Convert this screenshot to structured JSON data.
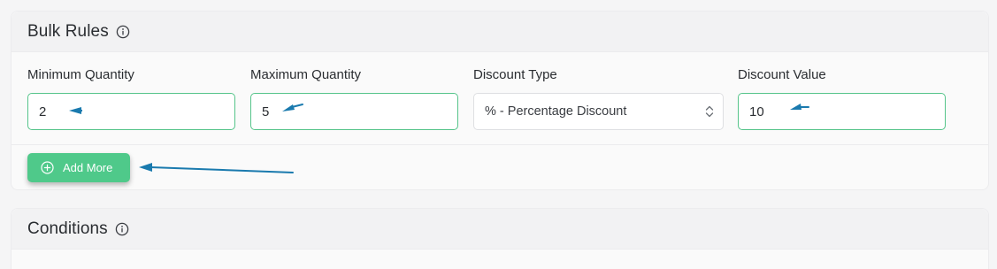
{
  "bulk_rules": {
    "title": "Bulk Rules",
    "fields": [
      {
        "label": "Minimum Quantity",
        "value": "2"
      },
      {
        "label": "Maximum Quantity",
        "value": "5"
      },
      {
        "label": "Discount Type",
        "value": "% - Percentage Discount"
      },
      {
        "label": "Discount Value",
        "value": "10"
      }
    ],
    "add_more_label": "Add More"
  },
  "conditions": {
    "title": "Conditions"
  },
  "colors": {
    "accent": "#4fc98a",
    "input_border": "#55c48a",
    "annotation_arrow": "#1a7aae"
  },
  "icons": [
    "info-icon",
    "sort-icon",
    "plus-circle-icon",
    "arrow-annotation"
  ]
}
